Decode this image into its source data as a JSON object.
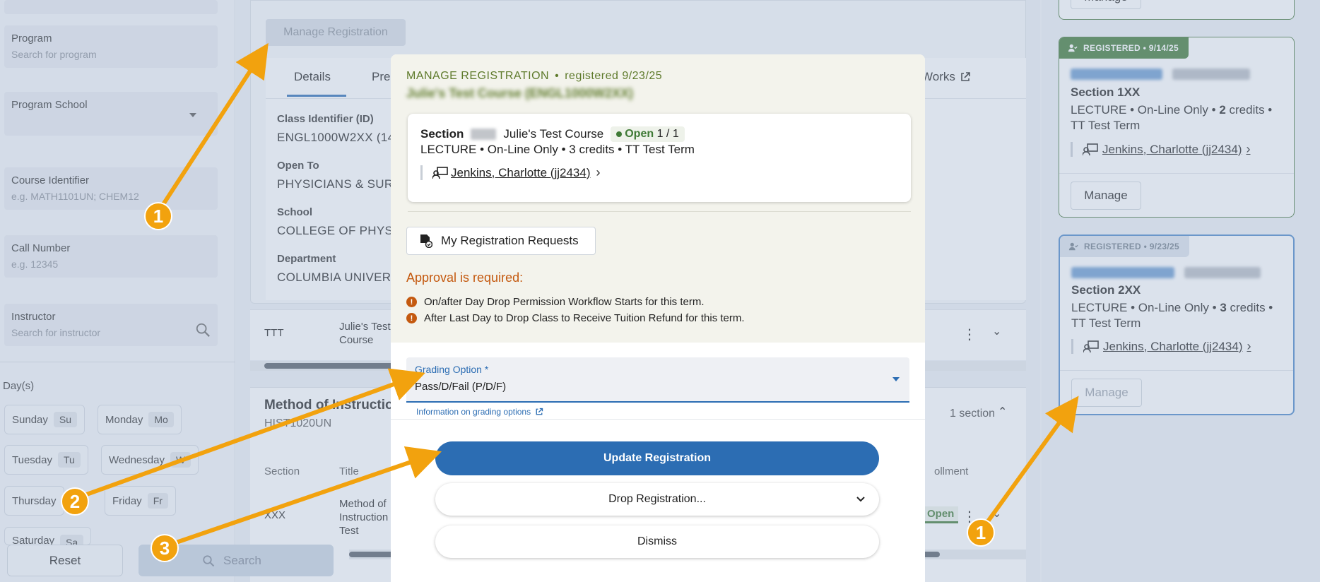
{
  "sidebar": {
    "program_label": "Program",
    "program_placeholder": "Search for program",
    "program_school_label": "Program School",
    "course_identifier_label": "Course Identifier",
    "course_identifier_placeholder": "e.g. MATH1101UN; CHEM12",
    "call_number_label": "Call Number",
    "call_number_placeholder": "e.g. 12345",
    "instructor_label": "Instructor",
    "instructor_placeholder": "Search for instructor",
    "days_label": "Day(s)",
    "days": [
      {
        "label": "Sunday",
        "abbr": "Su"
      },
      {
        "label": "Monday",
        "abbr": "Mo"
      },
      {
        "label": "Tuesday",
        "abbr": "Tu"
      },
      {
        "label": "Wednesday",
        "abbr": "W"
      },
      {
        "label": "Thursday",
        "abbr": ""
      },
      {
        "label": "Friday",
        "abbr": "Fr"
      },
      {
        "label": "Saturday",
        "abbr": "Sa"
      }
    ],
    "reset_label": "Reset",
    "search_label": "Search"
  },
  "main": {
    "manage_registration_label": "Manage Registration",
    "tabs": [
      {
        "label": "Details"
      },
      {
        "label": "Pre"
      },
      {
        "label": "Works"
      }
    ],
    "details": {
      "class_id_label": "Class Identifier (ID)",
      "class_id_value": "ENGL1000W2XX (14",
      "open_to_label": "Open To",
      "open_to_value": "PHYSICIANS & SUR",
      "school_label": "School",
      "school_value": "COLLEGE OF PHYS",
      "department_label": "Department",
      "department_value": "COLUMBIA UNIVER"
    },
    "row_ttt": {
      "code": "TTT",
      "title": "Julie's Test Course"
    },
    "card2": {
      "title": "Method of Instruction",
      "code": "HIST1020UN",
      "count": "1 section",
      "headers": [
        "Section",
        "Title",
        "ollment"
      ],
      "row": {
        "section": "XXX",
        "title": "Method of Instruction Test",
        "status": "Open"
      }
    }
  },
  "right_panel": {
    "cards": [
      {
        "badge": "REGISTERED • 9/14/25",
        "section": "Section 1XX",
        "meta_prefix": "LECTURE • On-Line Only • ",
        "credits": "2",
        "meta_suffix": " credits •",
        "term": "TT Test Term",
        "instructor": "Jenkins, Charlotte (jj2434)",
        "manage_label": "Manage"
      },
      {
        "badge": "REGISTERED • 9/23/25",
        "section": "Section 2XX",
        "meta_prefix": "LECTURE • On-Line Only • ",
        "credits": "3",
        "meta_suffix": " credits •",
        "term": "TT Test Term",
        "instructor": "Jenkins, Charlotte (jj2434)",
        "manage_label": "Manage"
      }
    ],
    "top_manage_label": "Manage"
  },
  "modal": {
    "header_label": "MANAGE REGISTRATION",
    "header_registered": "registered 9/23/25",
    "subtitle": "Julie's Test Course (ENGL1000W2XX)",
    "section_prefix": "Section",
    "course_name": "Julie's Test Course",
    "open_label": "Open",
    "open_count": "1 / 1",
    "section_meta": "LECTURE • On-Line Only • 3 credits • TT Test Term",
    "instructor": "Jenkins, Charlotte (jj2434)",
    "my_requests_label": "My Registration Requests",
    "approval_label": "Approval is required:",
    "warnings": [
      "On/after Day Drop Permission Workflow Starts for this term.",
      "After Last Day to Drop Class to Receive Tuition Refund for this term."
    ],
    "grading_label": "Grading Option *",
    "grading_value": "Pass/D/Fail (P/D/F)",
    "grading_info": "Information on grading options",
    "update_label": "Update Registration",
    "drop_label": "Drop Registration...",
    "dismiss_label": "Dismiss"
  },
  "annotations": [
    "1",
    "2",
    "3",
    "1"
  ],
  "colors": {
    "accent_blue": "#2c6db3",
    "registered_green": "#3f7a36",
    "approval_orange": "#c4590f",
    "annotation_orange": "#f2a20e",
    "header_olive": "#5e7a2b"
  }
}
